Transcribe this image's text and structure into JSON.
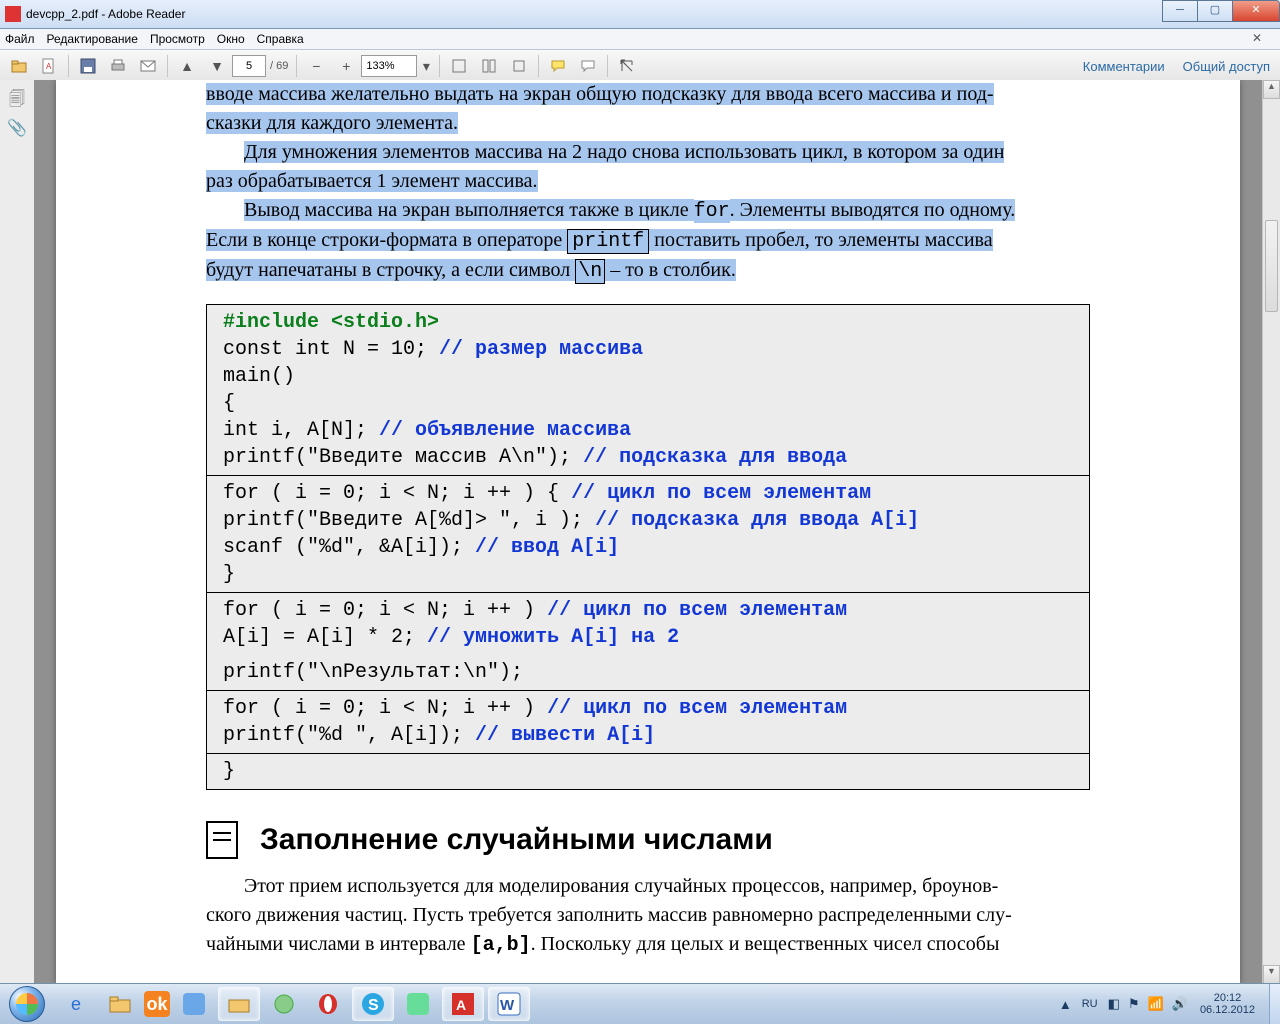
{
  "window": {
    "title": "devcpp_2.pdf - Adobe Reader"
  },
  "menu": {
    "items": [
      "Файл",
      "Редактирование",
      "Просмотр",
      "Окно",
      "Справка"
    ]
  },
  "toolbar": {
    "page_current": "5",
    "page_total": "/ 69",
    "zoom": "133%",
    "links": [
      "Комментарии",
      "Общий доступ"
    ]
  },
  "doc": {
    "p1a": "вводе массива желательно выдать на экран общую подсказку для ввода всего массива и под-",
    "p1b": "сказки для каждого элемента.",
    "p2a": "Для умножения элементов массива на 2 надо снова использовать цикл, в котором за один",
    "p2b": "раз обрабатывается 1 элемент массива.",
    "p3a": "Вывод массива на экран выполняется также в цикле ",
    "p3for": "for",
    "p3b": ". Элементы выводятся по одному.",
    "p4a": "Если в конце строки-формата в операторе ",
    "p4printf": "printf",
    "p4b": " поставить пробел, то элементы массива",
    "p5a": "будут напечатаны в строчку, а если символ ",
    "p5nl": "\\n",
    "p5b": " – то в столбик.",
    "code": {
      "s1l1_inc": "#include <stdio.h>",
      "s1l2a": "const int N = 10;       ",
      "s1l2c": "// размер массива",
      "s1l3": "main()",
      "s1l4": "{",
      "s1l5a": "int i, A[N];            ",
      "s1l5c": "// объявление массива",
      "s1l6a": "printf(\"Введите массив A\\n\");  ",
      "s1l6c": "// подсказка для ввода",
      "s2l1a": "for ( i = 0; i < N; i ++ ) {        ",
      "s2l1c": "// цикл по всем элементам",
      "s2l2a": "   printf(\"Введите A[%d]> \", i );  ",
      "s2l2c": "// подсказка для ввода A[i]",
      "s2l3a": "   scanf (\"%d\", &A[i]);            ",
      "s2l3c": "// ввод A[i]",
      "s2l4": "   }",
      "s3l1a": "for ( i = 0; i < N; i ++ ) ",
      "s3l1c": "// цикл по всем элементам",
      "s3l2a": "   A[i] = A[i] * 2;        ",
      "s3l2c": "// умножить A[i] на 2",
      "s3l3": "printf(\"\\nРезультат:\\n\");",
      "s4l1a": "for ( i = 0; i < N; i ++ ) ",
      "s4l1c": "// цикл по всем элементам",
      "s4l2a": "   printf(\"%d \", A[i]);   ",
      "s4l2c": "// вывести A[i]",
      "s5l1": "}"
    },
    "h2": "Заполнение случайными числами",
    "p6": "Этот прием используется для моделирования случайных процессов, например, броунов-",
    "p7": "ского движения частиц. Пусть требуется заполнить массив равномерно распределенными слу-",
    "p8a": "чайными числами в интервале ",
    "p8b": "[a,b]",
    "p8c": ". Поскольку для целых и вещественных чисел способы"
  },
  "tray": {
    "lang": "RU",
    "time": "20:12",
    "date": "06.12.2012"
  }
}
